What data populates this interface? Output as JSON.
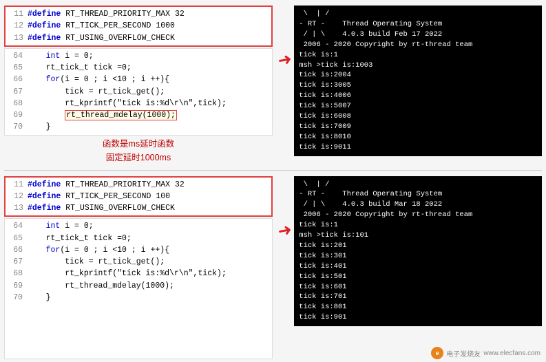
{
  "section1": {
    "code_top": {
      "lines": [
        {
          "num": "11",
          "content": "#define RT_THREAD_PRIORITY_MAX 32",
          "bold": true
        },
        {
          "num": "12",
          "content": "#define RT_TICK_PER_SECOND 1000",
          "bold": true
        },
        {
          "num": "13",
          "content": "#define RT_USING_OVERFLOW_CHECK",
          "bold": true
        }
      ]
    },
    "code_main": {
      "lines": [
        {
          "num": "64",
          "content": "    int i = 0;"
        },
        {
          "num": "65",
          "content": "    rt_tick_t tick =0;"
        },
        {
          "num": "66",
          "content": "    for(i = 0 ; i <10 ; i ++){"
        },
        {
          "num": "67",
          "content": "        tick = rt_tick_get();"
        },
        {
          "num": "68",
          "content": "        rt_kprintf(\"tick is:%d\\r\\n\",tick);"
        },
        {
          "num": "69",
          "content": "        rt_thread_mdelay(1000);",
          "highlight": true
        },
        {
          "num": "70",
          "content": "    }"
        }
      ]
    },
    "annotation": [
      "函数是ms延时函数",
      "固定延时1000ms"
    ],
    "terminal": {
      "logo_lines": [
        " \\ | /",
        "- RT -    Thread Operating System",
        " / | \\    4.0.3 build Feb 17 2022",
        " 2006 - 2020 Copyright by rt-thread team",
        "tick is:1",
        "msh >tick is:1003",
        "tick is:2004",
        "tick is:3005",
        "tick is:4006",
        "tick is:5007",
        "tick is:6008",
        "tick is:7009",
        "tick is:8010",
        "tick is:9011"
      ]
    }
  },
  "section2": {
    "code_top": {
      "lines": [
        {
          "num": "11",
          "content": "#define RT_THREAD_PRIORITY_MAX 32",
          "bold": true
        },
        {
          "num": "12",
          "content": "#define RT_TICK_PER_SECOND 100",
          "bold": true
        },
        {
          "num": "13",
          "content": "#define RT_USING_OVERFLOW_CHECK",
          "bold": true
        }
      ]
    },
    "code_main": {
      "lines": [
        {
          "num": "64",
          "content": "    int i = 0;"
        },
        {
          "num": "65",
          "content": "    rt_tick_t tick =0;"
        },
        {
          "num": "66",
          "content": "    for(i = 0 ; i <10 ; i ++){"
        },
        {
          "num": "67",
          "content": "        tick = rt_tick_get();"
        },
        {
          "num": "68",
          "content": "        rt_kprintf(\"tick is:%d\\r\\n\",tick);"
        },
        {
          "num": "69",
          "content": "        rt_thread_mdelay(1000);"
        },
        {
          "num": "70",
          "content": "    }"
        }
      ]
    },
    "terminal": {
      "logo_lines": [
        " \\ | /",
        "- RT -    Thread Operating System",
        " / | \\    4.0.3 build Mar 18 2022",
        " 2006 - 2020 Copyright by rt-thread team",
        "tick is:1",
        "msh >tick is:101",
        "tick is:201",
        "tick is:301",
        "tick is:401",
        "tick is:501",
        "tick is:601",
        "tick is:701",
        "tick is:801",
        "tick is:901"
      ]
    }
  },
  "watermark": {
    "text": "电子发烧友",
    "url": "www.elecfans.com"
  }
}
